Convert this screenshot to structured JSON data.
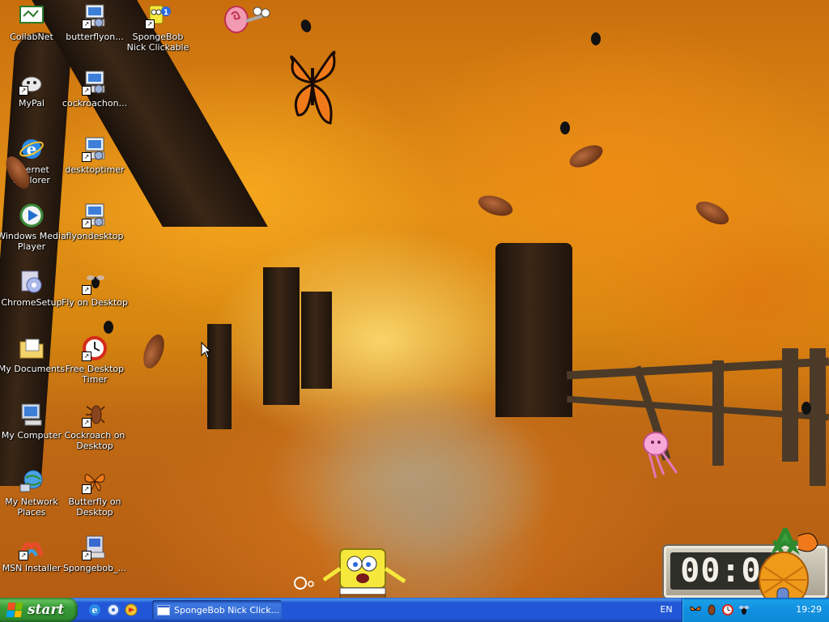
{
  "desktop": {
    "icons": [
      {
        "label": "CollabNet",
        "icon": "collabnet-icon"
      },
      {
        "label": "butterflyon...",
        "icon": "butterfly-installer-icon"
      },
      {
        "label": "SpongeBob\nNick Clickable",
        "icon": "spongebob-icon"
      },
      {
        "label": "MyPal",
        "icon": "mypal-icon"
      },
      {
        "label": "cockroachon...",
        "icon": "cockroach-installer-icon"
      },
      {
        "label": "Internet\nExplorer",
        "icon": "internet-explorer-icon"
      },
      {
        "label": "desktoptimer",
        "icon": "desktoptimer-installer-icon"
      },
      {
        "label": "Windows Media\nPlayer",
        "icon": "windows-media-player-icon"
      },
      {
        "label": "flyondesktop",
        "icon": "flyondesktop-installer-icon"
      },
      {
        "label": "ChromeSetup",
        "icon": "chrome-setup-icon"
      },
      {
        "label": "Fly on Desktop",
        "icon": "fly-on-desktop-icon"
      },
      {
        "label": "My Documents",
        "icon": "my-documents-icon"
      },
      {
        "label": "Free Desktop\nTimer",
        "icon": "free-desktop-timer-icon"
      },
      {
        "label": "My Computer",
        "icon": "my-computer-icon"
      },
      {
        "label": "Cockroach on\nDesktop",
        "icon": "cockroach-on-desktop-icon"
      },
      {
        "label": "My Network\nPlaces",
        "icon": "my-network-places-icon"
      },
      {
        "label": "Butterfly on\nDesktop",
        "icon": "butterfly-on-desktop-icon"
      },
      {
        "label": "MSN Installer",
        "icon": "msn-installer-icon"
      },
      {
        "label": "Spongebob_...",
        "icon": "spongebob-installer-icon"
      }
    ]
  },
  "timer_widget": {
    "display": "00:00"
  },
  "taskbar": {
    "start_label": "start",
    "quick_launch": [
      "internet-explorer-icon",
      "media-icon",
      "desktop-icon"
    ],
    "open_windows": [
      {
        "label": "SpongeBob Nick Click..."
      }
    ],
    "language": "EN",
    "clock": "19:29",
    "tray_icons": [
      "butterfly-icon",
      "cockroach-icon",
      "timer-icon",
      "fly-icon"
    ]
  },
  "colors": {
    "taskbar_blue": "#2157d7",
    "start_green": "#379d37",
    "tray_blue": "#1290e0"
  }
}
